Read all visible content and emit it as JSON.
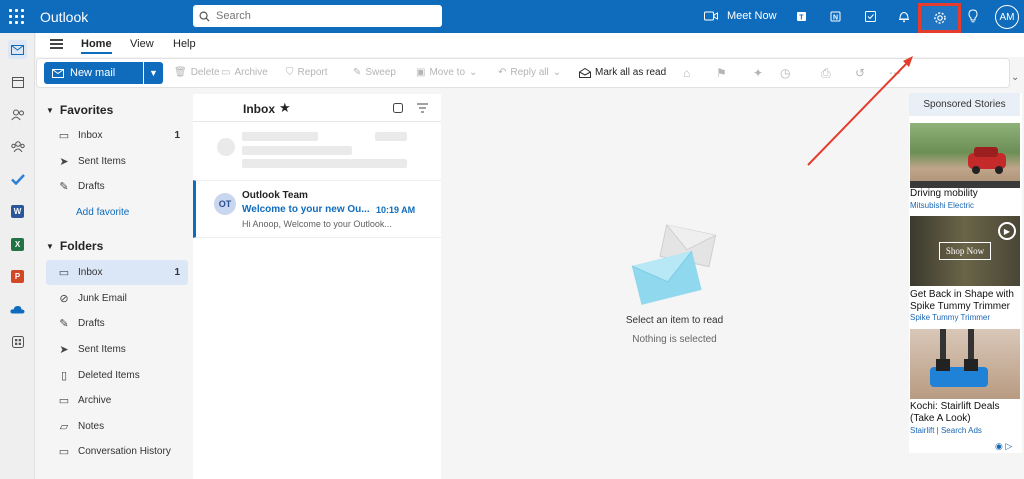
{
  "topbar": {
    "app_title": "Outlook",
    "search_placeholder": "Search",
    "meet_now_label": "Meet Now",
    "avatar_initials": "AM"
  },
  "ribbon": {
    "tabs": [
      "Home",
      "View",
      "Help"
    ],
    "active_tab": "Home",
    "new_mail_label": "New mail",
    "buttons": {
      "delete": "Delete",
      "archive": "Archive",
      "report": "Report",
      "sweep": "Sweep",
      "move_to": "Move to",
      "reply_all": "Reply all",
      "mark_all_read": "Mark all as read"
    }
  },
  "folders": {
    "favorites_header": "Favorites",
    "favorites": [
      {
        "label": "Inbox",
        "count": "1",
        "icon": "inbox-icon"
      },
      {
        "label": "Sent Items",
        "count": "",
        "icon": "send-icon"
      },
      {
        "label": "Drafts",
        "count": "",
        "icon": "pencil-icon"
      }
    ],
    "add_favorite": "Add favorite",
    "folders_header": "Folders",
    "items": [
      {
        "label": "Inbox",
        "count": "1",
        "icon": "inbox-icon"
      },
      {
        "label": "Junk Email",
        "count": "",
        "icon": "junk-icon"
      },
      {
        "label": "Drafts",
        "count": "",
        "icon": "pencil-icon"
      },
      {
        "label": "Sent Items",
        "count": "",
        "icon": "send-icon"
      },
      {
        "label": "Deleted Items",
        "count": "",
        "icon": "trash-icon"
      },
      {
        "label": "Archive",
        "count": "",
        "icon": "archive-icon"
      },
      {
        "label": "Notes",
        "count": "",
        "icon": "note-icon"
      },
      {
        "label": "Conversation History",
        "count": "",
        "icon": "folder-icon"
      }
    ]
  },
  "message_list": {
    "title": "Inbox",
    "message": {
      "avatar": "OT",
      "sender": "Outlook Team",
      "subject": "Welcome to your new Ou...",
      "time": "10:19 AM",
      "preview": "Hi Anoop, Welcome to your Outlook..."
    }
  },
  "reading_pane": {
    "title": "Select an item to read",
    "subtitle": "Nothing is selected"
  },
  "ads": {
    "header": "Sponsored Stories",
    "items": [
      {
        "title": "Driving mobility",
        "source": "Mitsubishi Electric"
      },
      {
        "title": "Get Back in Shape with Spike Tummy Trimmer",
        "source": "Spike Tummy Trimmer",
        "overlay_button": "Shop Now"
      },
      {
        "title": "Kochi: Stairlift Deals (Take A Look)",
        "source": "Stairlift | Search Ads"
      }
    ]
  },
  "colors": {
    "brand": "#0f6cbd",
    "highlight": "#e53c2e"
  }
}
